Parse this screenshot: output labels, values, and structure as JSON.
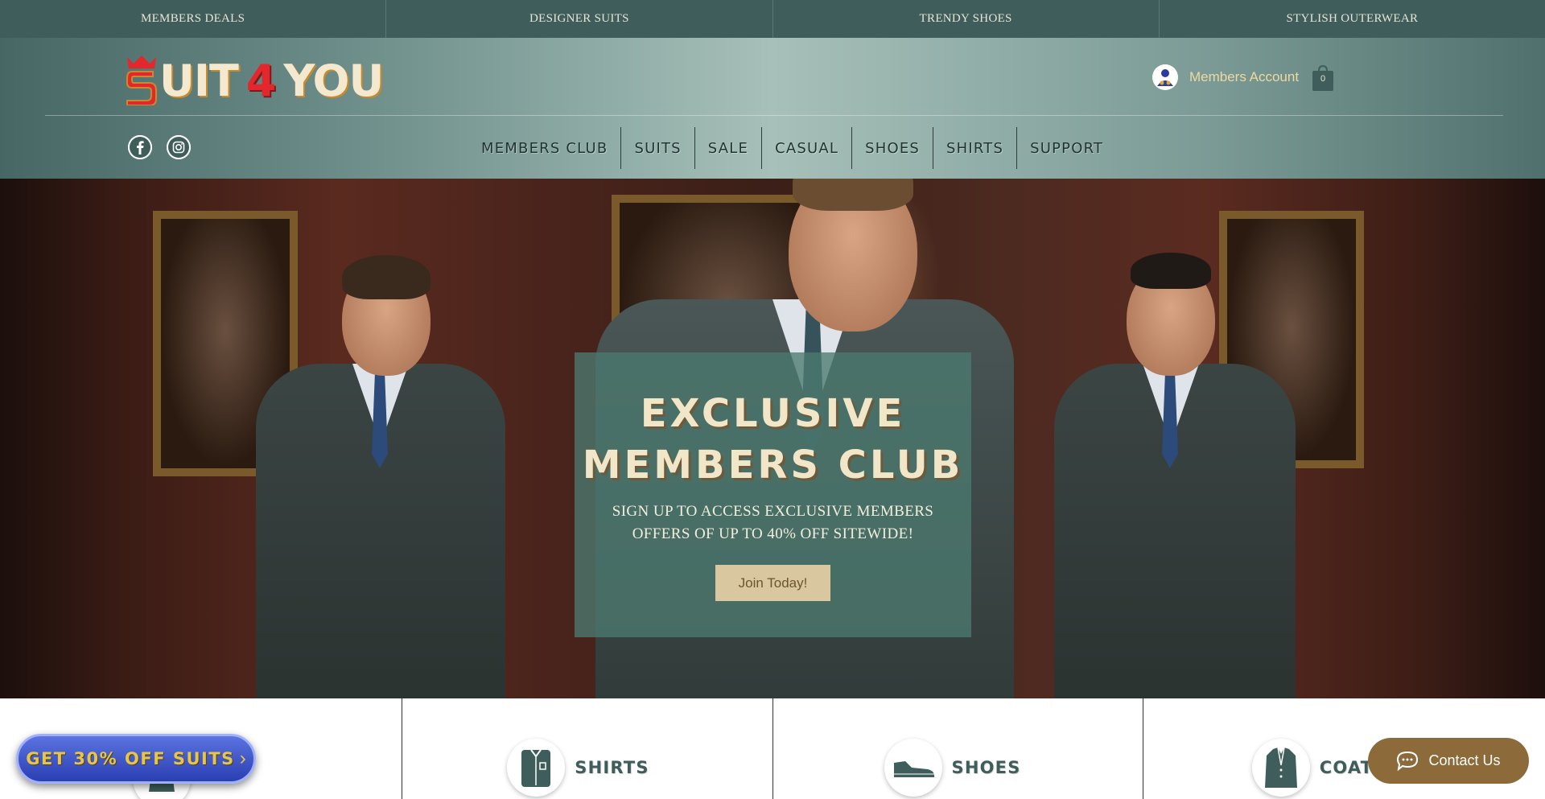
{
  "promo_strip": {
    "items": [
      "MEMBERS DEALS",
      "DESIGNER SUITS",
      "TRENDY SHOES",
      "STYLISH OUTERWEAR"
    ]
  },
  "header": {
    "logo": {
      "part1": "UIT",
      "part2": "4",
      "part3": "YOU",
      "full": "SUIT4YOU"
    },
    "account_label": "Members Account",
    "cart_count": "0",
    "social": [
      "facebook-icon",
      "instagram-icon"
    ]
  },
  "nav": {
    "items": [
      "MEMBERS CLUB",
      "SUITS",
      "SALE",
      "CASUAL",
      "SHOES",
      "SHIRTS",
      "SUPPORT"
    ]
  },
  "hero": {
    "title_line1": "EXCLUSIVE",
    "title_line2": "MEMBERS CLUB",
    "subtitle_line1": "SIGN UP TO ACCESS EXCLUSIVE MEMBERS",
    "subtitle_line2": "OFFERS OF UP TO 40% OFF SITEWIDE!",
    "cta": "Join Today!"
  },
  "categories": {
    "items": [
      {
        "label": "",
        "icon": "suit-icon"
      },
      {
        "label": "SHIRTS",
        "icon": "shirt-icon"
      },
      {
        "label": "SHOES",
        "icon": "shoe-icon"
      },
      {
        "label": "COAT",
        "icon": "coat-icon"
      }
    ]
  },
  "floating": {
    "offer_label": "GET 30% OFF SUITS",
    "contact_label": "Contact Us"
  },
  "colors": {
    "brand_green": "#3e5d5b",
    "accent_gold": "#d9c89f",
    "logo_red": "#e3272c",
    "offer_blue": "#2a3fb2",
    "contact_brown": "#8c6a3a"
  }
}
